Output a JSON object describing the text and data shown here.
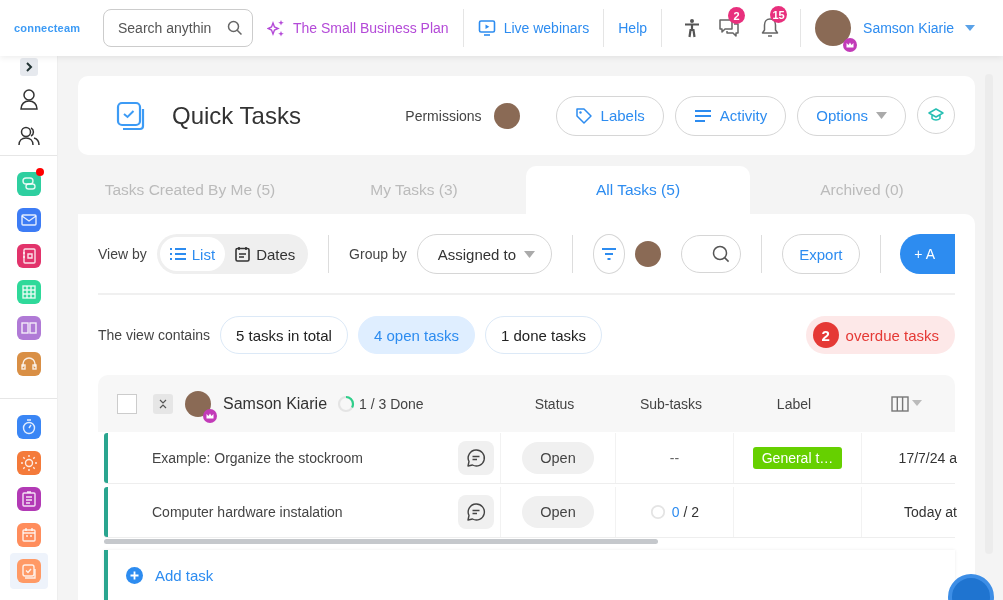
{
  "topbar": {
    "logo": "connecteam",
    "search": {
      "placeholder": "Search anythin"
    },
    "links": [
      {
        "kind": "plan",
        "label": "The Small Business Plan"
      },
      {
        "kind": "webinars",
        "label": "Live webinars"
      },
      {
        "kind": "help",
        "label": "Help"
      }
    ],
    "notifications": [
      {
        "kind": "chat",
        "count": "2"
      },
      {
        "kind": "bell",
        "count": "15"
      }
    ],
    "user": {
      "name": "Samson Kiarie"
    }
  },
  "sidebar": {
    "groups": [
      {
        "apps": [
          {
            "kind": "chat",
            "color": "#2ecfa0",
            "selected": false,
            "dot": true
          },
          {
            "kind": "mail",
            "color": "#3d7cf5",
            "selected": false,
            "dot": false
          },
          {
            "kind": "book",
            "color": "#e2336b",
            "selected": false,
            "dot": false
          },
          {
            "kind": "grid",
            "color": "#2fd99a",
            "selected": false,
            "dot": false
          },
          {
            "kind": "board",
            "color": "#b07ad6",
            "selected": false,
            "dot": false
          },
          {
            "kind": "headset",
            "color": "#d98f45",
            "selected": false,
            "dot": false
          }
        ]
      },
      {
        "apps": [
          {
            "kind": "timer",
            "color": "#3a86f5",
            "selected": false,
            "dot": false
          },
          {
            "kind": "sun",
            "color": "#f47a3a",
            "selected": false,
            "dot": false
          },
          {
            "kind": "clipboard",
            "color": "#b23ab5",
            "selected": false,
            "dot": false
          },
          {
            "kind": "calendar",
            "color": "#ff8d5c",
            "selected": false,
            "dot": false
          },
          {
            "kind": "tasks",
            "color": "#ff9a66",
            "selected": true,
            "dot": false
          }
        ]
      }
    ]
  },
  "header": {
    "title": "Quick Tasks",
    "permissions": "Permissions",
    "buttons": [
      {
        "kind": "labels",
        "label": "Labels"
      },
      {
        "kind": "activity",
        "label": "Activity"
      },
      {
        "kind": "options",
        "label": "Options"
      }
    ]
  },
  "tabs": [
    {
      "label": "Tasks Created By Me (5)",
      "selected": false
    },
    {
      "label": "My Tasks (3)",
      "selected": false
    },
    {
      "label": "All Tasks (5)",
      "selected": true
    },
    {
      "label": "Archived (0)",
      "selected": false
    }
  ],
  "toolbar": {
    "view_by": "View by",
    "views": [
      {
        "kind": "list",
        "label": "List",
        "selected": true
      },
      {
        "kind": "dates",
        "label": "Dates",
        "selected": false
      }
    ],
    "group_by": "Group by",
    "group_value": "Assigned to",
    "export": "Export",
    "add": "+ A"
  },
  "summary": {
    "label": "The view contains",
    "counts": [
      {
        "label": "5 tasks in total",
        "selected": false
      },
      {
        "label": "4 open tasks",
        "selected": true
      },
      {
        "label": "1 done tasks",
        "selected": false
      }
    ],
    "overdue": {
      "count": "2",
      "label": "overdue tasks"
    }
  },
  "table": {
    "group": {
      "name": "Samson Kiarie",
      "checked": false,
      "level": 0.33,
      "progress": "1 / 3 Done"
    },
    "columns": [
      "Status",
      "Sub-tasks",
      "Label"
    ],
    "rows": [
      {
        "task": "Example: Organize the stockroom",
        "status": "Open",
        "subtasks": {
          "kind": "none",
          "text": "--"
        },
        "label": {
          "text": "General t…",
          "color": "#66d000"
        },
        "date": "17/7/24 a"
      },
      {
        "task": "Computer hardware instalation",
        "status": "Open",
        "subtasks": {
          "kind": "progress",
          "level": 0,
          "done": "0",
          "total": "/ 2"
        },
        "label": null,
        "date": "Today at"
      }
    ],
    "add_task": "Add task"
  }
}
